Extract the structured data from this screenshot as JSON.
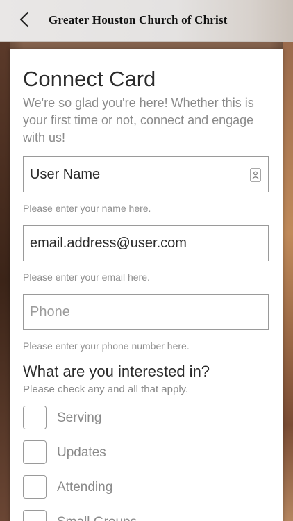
{
  "header": {
    "title": "Greater Houston Church of Christ",
    "back_icon": "chevron-left-icon"
  },
  "card": {
    "title": "Connect Card",
    "subtitle": "We're so glad you're here! Whether this is your first time or not, connect and engage with us!"
  },
  "fields": {
    "name": {
      "value": "User Name",
      "helper": "Please enter your name here.",
      "icon": "contact-card-icon"
    },
    "email": {
      "value": "email.address@user.com",
      "helper": "Please enter your email here."
    },
    "phone": {
      "placeholder": "Phone",
      "value": "",
      "helper": "Please enter your phone number here."
    }
  },
  "interests": {
    "title": "What are you interested in?",
    "subtitle": "Please check any and all that apply.",
    "options": [
      {
        "label": "Serving",
        "checked": false
      },
      {
        "label": "Updates",
        "checked": false
      },
      {
        "label": "Attending",
        "checked": false
      },
      {
        "label": "Small Groups",
        "checked": false
      }
    ]
  }
}
